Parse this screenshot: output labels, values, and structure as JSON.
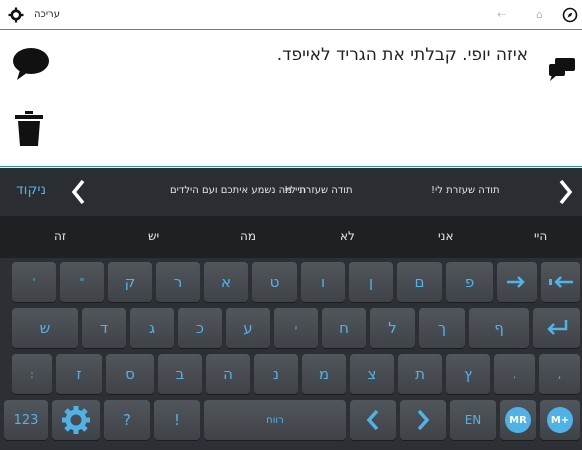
{
  "topbar": {
    "edit_label": "עריכה",
    "icons": [
      "gear-icon",
      "forward-arrow-icon",
      "back-arrow-icon",
      "home-icon",
      "compass-icon"
    ]
  },
  "message": {
    "text": "איזה יופי. קבלתי את הגריד לאייפד."
  },
  "predictions": {
    "niqqud_label": "ניקוד",
    "items": [
      "היי מה נשמע איתכם ועם הילדים",
      "תודה שעזרת לי!",
      "תודה שעזרת לי!"
    ]
  },
  "word_suggestions": [
    "היי",
    "אני",
    "לא",
    "מה",
    "יש",
    "זה"
  ],
  "keyboard": {
    "row1": [
      "פ",
      "ם",
      "ן",
      "ו",
      "ט",
      "א",
      "ר",
      "ק",
      "\"",
      "'"
    ],
    "row2": [
      "ף",
      "ך",
      "ל",
      "ח",
      "י",
      "ע",
      "כ",
      "ג",
      "ד",
      "ש"
    ],
    "row3": [
      ",",
      ".",
      "ץ",
      "ת",
      "צ",
      "מ",
      "נ",
      "ה",
      "ב",
      "ס",
      "ז",
      ":"
    ],
    "row4": {
      "numbers": "123",
      "question": "?",
      "exclaim": "!",
      "space": "רווח",
      "lang": "EN",
      "mr": "MR",
      "mplus": "M+"
    }
  },
  "colors": {
    "accent": "#4fb3e8",
    "teal_line": "#2a9d8a",
    "key_bg": "#484c51",
    "bar_bg": "#2a2d31"
  }
}
